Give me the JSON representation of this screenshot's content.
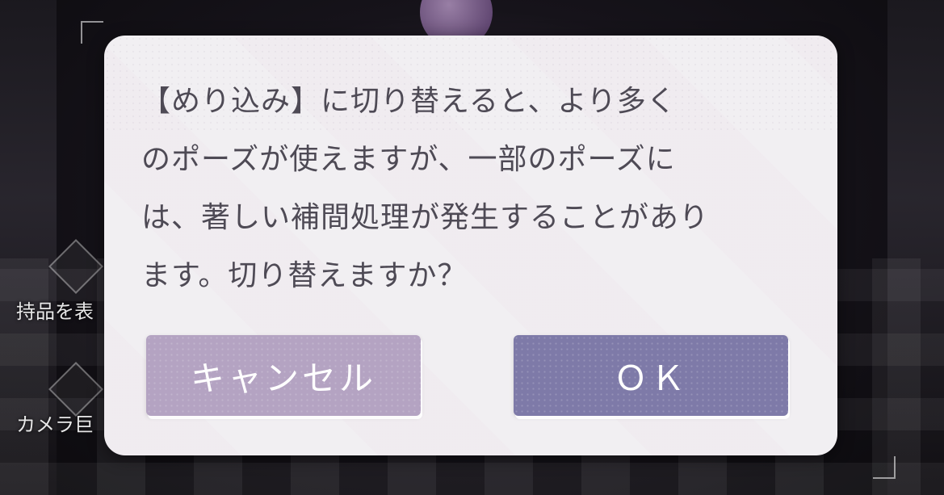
{
  "background": {
    "side_labels": [
      "持品を表",
      "カメラ巨"
    ]
  },
  "dialog": {
    "message_lines": [
      "【めり込み】に切り替えると、より多く",
      "のポーズが使えますが、一部のポーズに",
      "は、著しい補間処理が発生することがあり",
      "ます。切り替えますか？"
    ],
    "cancel_label": "キャンセル",
    "ok_label": "ＯＫ"
  },
  "colors": {
    "dialog_bg": "#f1eff2",
    "text": "#4e4a55",
    "cancel_button": "#b4a3c2",
    "ok_button": "#7e7aa8"
  }
}
